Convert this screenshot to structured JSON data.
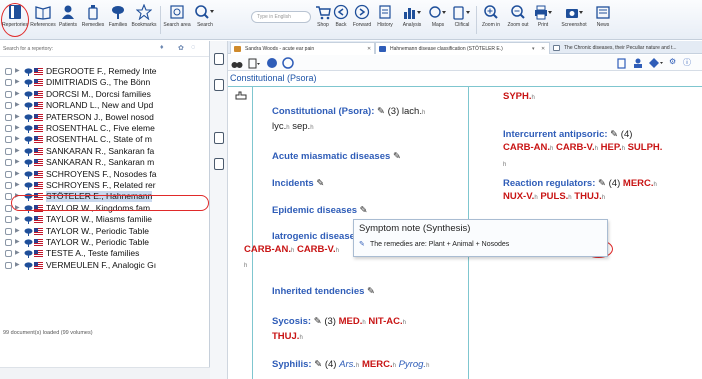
{
  "toolbar": {
    "groups": [
      {
        "label": "Repertories"
      },
      {
        "label": "References"
      },
      {
        "label": "Patients"
      },
      {
        "label": "Remedies"
      },
      {
        "label": "Families"
      },
      {
        "label": "Bookmarks"
      },
      {
        "label": "Search area"
      },
      {
        "label": "Search"
      },
      {
        "label": "Shop"
      },
      {
        "label": "Back"
      },
      {
        "label": "Forward"
      },
      {
        "label": "History"
      },
      {
        "label": "Analysis"
      },
      {
        "label": "Maps"
      },
      {
        "label": "Clifical"
      },
      {
        "label": "Zoom in"
      },
      {
        "label": "Zoom out"
      },
      {
        "label": "Print"
      },
      {
        "label": "Screenshot"
      },
      {
        "label": "News"
      }
    ],
    "search_placeholder": "Type in English"
  },
  "left_panel": {
    "search_label": "Search for a repertory:",
    "items": [
      {
        "label": "DEGROOTE F., Remedy Inte"
      },
      {
        "label": "DIMITRIADIS G., The Bönn"
      },
      {
        "label": "DORCSI M., Dorcsi families"
      },
      {
        "label": "NORLAND L., New and Upd"
      },
      {
        "label": "PATERSON J., Bowel nosod"
      },
      {
        "label": "ROSENTHAL C., Five eleme"
      },
      {
        "label": "ROSENTHAL C., State of m"
      },
      {
        "label": "SANKARAN R., Sankaran fa"
      },
      {
        "label": "SANKARAN R., Sankaran m"
      },
      {
        "label": "SCHROYENS F., Nosodes fa"
      },
      {
        "label": "SCHROYENS F., Related rer"
      },
      {
        "label": "STÖTELER E., Hahnemann"
      },
      {
        "label": "TAYLOR W., Kingdoms fam"
      },
      {
        "label": "TAYLOR W., Miasms familie"
      },
      {
        "label": "TAYLOR W., Periodic Table"
      },
      {
        "label": "TAYLOR W., Periodic Table"
      },
      {
        "label": "TESTE A., Teste families"
      },
      {
        "label": "VERMEULEN F., Analogic Gı"
      }
    ],
    "footer": "99 document(s) loaded (99 volumes)"
  },
  "tabs": [
    {
      "label": "Sandra Woods - acute ear pain"
    },
    {
      "label": "Hahnemann disease classification (STÖTELER E.)"
    },
    {
      "label": "The Chronic diseases, their Peculiar nature and t..."
    }
  ],
  "content": {
    "breadcrumb": "Constitutional (Psora)",
    "left_col": [
      {
        "title": "Constitutional (Psora):",
        "count": "(3)",
        "rem1": "lach.",
        "rem2": "lyc.",
        "rem3": "sep."
      },
      {
        "title": "Acute miasmatic diseases"
      },
      {
        "title": "Incidents"
      },
      {
        "title": "Epidemic diseases"
      },
      {
        "title": "Iatrogenic diseases:",
        "rem1": "CARB-AN.",
        "rem2": "CARB-V."
      },
      {
        "title": "Inherited tendencies"
      },
      {
        "title": "Sycosis:",
        "count": "(3)",
        "rem1": "MED.",
        "rem2": "NIT-AC.",
        "rem3": "THUJ."
      },
      {
        "title": "Syphilis:",
        "count": "(4)",
        "rem1": "Ars.",
        "rem2": "MERC.",
        "rem3": "Pyrog."
      }
    ],
    "right_col": {
      "top_rem": "SYPH.",
      "antipsoric_title": "Intercurrent antipsoric:",
      "antipsoric_count": "(4)",
      "antipsoric_rems": [
        "CARB-AN.",
        "CARB-V.",
        "HEP.",
        "SULPH."
      ],
      "regulators_title": "Reaction regulators:",
      "regulators_count": "(4)",
      "regulators_rems": [
        "MERC.",
        "NUX-V.",
        "PULS.",
        "THUJ."
      ]
    }
  },
  "tooltip": {
    "title": "Symptom note (Synthesis)",
    "body": "The remedies are: Plant + Animal + Nosodes"
  },
  "colors": {
    "accent": "#2f5db8",
    "remedy": "#c81414",
    "highlight": "#e02a2a"
  }
}
